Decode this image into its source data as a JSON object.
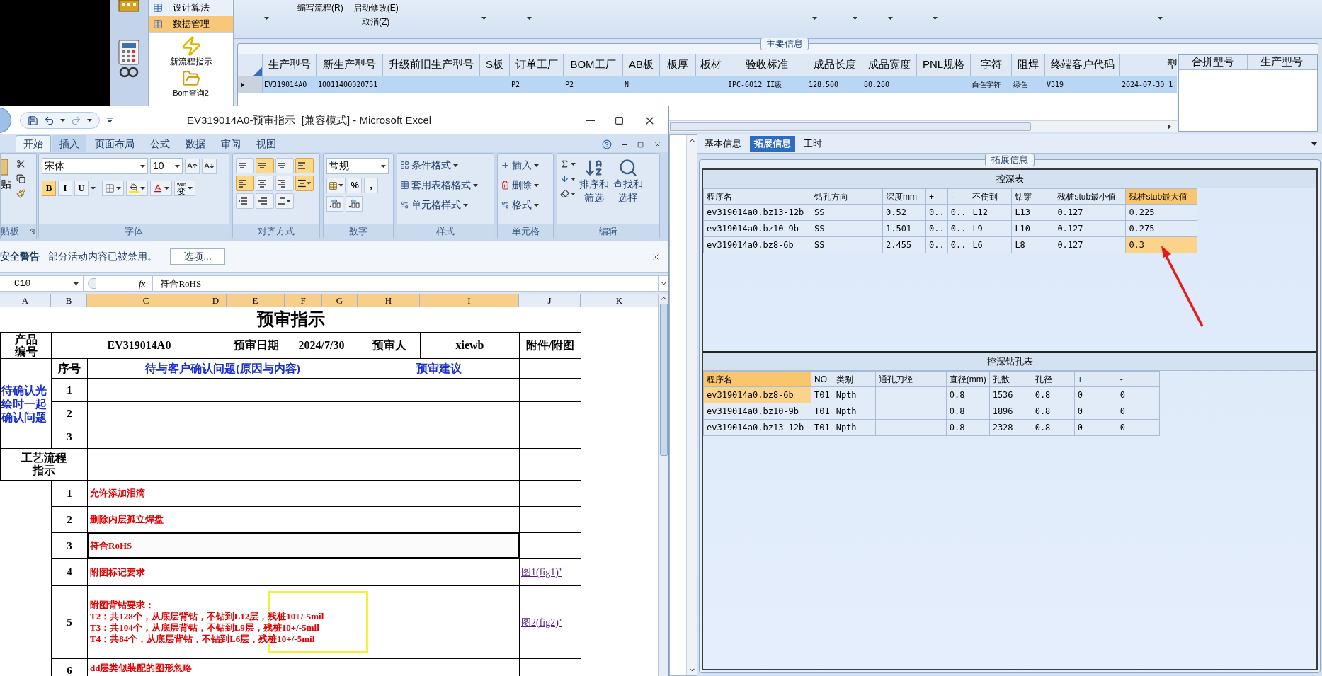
{
  "app": {
    "nav": [
      {
        "label": "设计算法",
        "selected": false
      },
      {
        "label": "数据管理",
        "selected": true
      }
    ],
    "shortcuts": [
      {
        "label": "新流程指示",
        "kind": "flash"
      },
      {
        "label": "Bom查询2",
        "kind": "folder"
      }
    ],
    "toolbar": {
      "left_command": "编写流程(R)",
      "right_commands": [
        "启动修改(E)",
        "取消(Z)"
      ]
    },
    "main_group": {
      "title": "主要信息",
      "columns": [
        "生产型号",
        "新生产型号",
        "升级前旧生产型号",
        "S板",
        "订单工厂",
        "BOM工厂",
        "AB板",
        "板厚",
        "板材",
        "验收标准",
        "成品长度",
        "成品宽度",
        "PNL规格",
        "字符",
        "阻焊",
        "终端客户代码",
        "型"
      ],
      "rows": [
        {
          "selected": true,
          "cells": [
            "EV319014A0",
            "10011400020751",
            null,
            null,
            "P2",
            "P2",
            "N",
            null,
            null,
            "IPC-6012 II级",
            "128.500",
            "80.280",
            null,
            "白色字符",
            "绿色",
            "V319",
            "2024-07-30 1"
          ]
        }
      ]
    },
    "merge_panel": {
      "columns": [
        "合拼型号",
        "生产型号"
      ]
    }
  },
  "excel": {
    "title": "EV319014A0-预审指示  [兼容模式] - Microsoft Excel",
    "tabs": [
      {
        "label": "开始",
        "selected": true
      },
      {
        "label": "插入",
        "selected": false
      },
      {
        "label": "页面布局",
        "selected": false
      },
      {
        "label": "公式",
        "selected": false
      },
      {
        "label": "数据",
        "selected": false
      },
      {
        "label": "审阅",
        "selected": false
      },
      {
        "label": "视图",
        "selected": false
      }
    ],
    "ribbon": {
      "clipboard": {
        "paste": "贴",
        "label": "贴板"
      },
      "font": {
        "name": "宋体",
        "size": "10",
        "buttons": [
          {
            "label": "B",
            "on": true
          },
          {
            "label": "I",
            "on": false
          },
          {
            "label": "U",
            "on": false
          }
        ],
        "phonetic_top": "wén",
        "phonetic": "变",
        "label": "字体"
      },
      "alignment": {
        "buttons": [
          {
            "kind": "top",
            "on": false
          },
          {
            "kind": "middle",
            "on": true
          },
          {
            "kind": "bottom",
            "on": false
          },
          {
            "kind": "wrap",
            "on": true
          },
          {
            "kind": "left",
            "on": true
          },
          {
            "kind": "center",
            "on": false
          },
          {
            "kind": "right",
            "on": false
          },
          {
            "kind": "merge",
            "on": true
          },
          {
            "kind": "outdent",
            "on": false
          },
          {
            "kind": "indent",
            "on": false
          },
          {
            "kind": "orient",
            "on": false
          }
        ],
        "label": "对齐方式"
      },
      "number": {
        "format": "常规",
        "symbols": [
          "%",
          ","
        ],
        "label": "数字"
      },
      "styles": {
        "items": [
          "条件格式",
          "套用表格格式",
          "单元格样式"
        ],
        "label": "样式"
      },
      "cells": {
        "items": [
          "插入",
          "删除",
          "格式"
        ],
        "label": "单元格"
      },
      "editing": {
        "items": [
          "排序和筛选",
          "查找和选择"
        ],
        "label": "编辑"
      }
    },
    "security_bar": {
      "title": "安全警告",
      "message": "部分活动内容已被禁用。",
      "button": "选项..."
    },
    "formula_bar": {
      "name_box": "C10",
      "function_label": "fx",
      "value": "符合RoHS"
    },
    "columns": [
      {
        "label": "A",
        "selected": false
      },
      {
        "label": "B",
        "selected": false
      },
      {
        "label": "C",
        "selected": true
      },
      {
        "label": "D",
        "selected": true
      },
      {
        "label": "E",
        "selected": true
      },
      {
        "label": "F",
        "selected": true
      },
      {
        "label": "G",
        "selected": true
      },
      {
        "label": "H",
        "selected": true
      },
      {
        "label": "I",
        "selected": true
      },
      {
        "label": "J",
        "selected": false
      },
      {
        "label": "K",
        "selected": false
      }
    ],
    "sheet": {
      "title": "预审指示",
      "header": {
        "product_label": "产品编号",
        "product": "EV319014A0",
        "date_label": "预审日期",
        "date": "2024/7/30",
        "reviewer_label": "预审人",
        "reviewer": "xiewb",
        "attachment_label": "附件/附图"
      },
      "questions": {
        "section": "待确认光绘时一起确认问题",
        "no_label": "序号",
        "question_label": "待与客户确认问题(原因与内容)",
        "advice_label": "预审建议",
        "rows": [
          "1",
          "2",
          "3"
        ]
      },
      "process": {
        "section": "工艺流程指示",
        "rows": [
          {
            "no": "1",
            "lines": [
              "允许添加泪滴"
            ],
            "selected": false
          },
          {
            "no": "2",
            "lines": [
              "删除内层孤立焊盘"
            ],
            "selected": false
          },
          {
            "no": "3",
            "lines": [
              "符合RoHS"
            ],
            "selected": true
          },
          {
            "no": "4",
            "lines": [
              "附图标记要求"
            ],
            "selected": false,
            "link": "图1(fig1)’"
          },
          {
            "no": "5",
            "lines": [
              "附图背钻要求：",
              "T2：共128个，从底层背钻，不钻到L12层，残桩10+/-5mil",
              "T3：共104个，从底层背钻，不钻到L9层，残桩10+/-5mil",
              "T4：共84个，从底层背钻，不钻到L6层，残桩10+/-5mil"
            ],
            "selected": false,
            "link": "图2(fig2)’",
            "highlighted": true
          },
          {
            "no": "6",
            "lines": [
              "dd层类似装配的图形忽略"
            ],
            "selected": false
          }
        ]
      }
    }
  },
  "detail": {
    "tabs": [
      {
        "label": "基本信息",
        "selected": false
      },
      {
        "label": "拓展信息",
        "selected": true
      },
      {
        "label": "工时",
        "selected": false
      }
    ],
    "group_title": "拓展信息",
    "depth_table": {
      "title": "控深表",
      "columns": [
        {
          "label": "程序名",
          "selected": false
        },
        {
          "label": "钻孔方向",
          "selected": false
        },
        {
          "label": "深度mm",
          "selected": false
        },
        {
          "label": "+",
          "selected": false
        },
        {
          "label": "-",
          "selected": false
        },
        {
          "label": "不伤到",
          "selected": false
        },
        {
          "label": "钻穿",
          "selected": false
        },
        {
          "label": "残桩stub最小值",
          "selected": false
        },
        {
          "label": "残桩stub最大值",
          "selected": true
        }
      ],
      "rows": [
        {
          "selected": false,
          "cells": [
            "ev319014a0.bz13-12b",
            "SS",
            "0.52",
            "0..",
            "0..",
            "L12",
            "L13",
            "0.127",
            "0.225"
          ]
        },
        {
          "selected": false,
          "cells": [
            "ev319014a0.bz10-9b",
            "SS",
            "1.501",
            "0..",
            "0..",
            "L9",
            "L10",
            "0.127",
            "0.275"
          ]
        },
        {
          "selected": true,
          "cells": [
            "ev319014a0.bz8-6b",
            "SS",
            "2.455",
            "0..",
            "0..",
            "L6",
            "L8",
            "0.127",
            "0.3"
          ]
        }
      ]
    },
    "drill_table": {
      "title": "控深钻孔表",
      "columns": [
        {
          "label": "程序名",
          "selected": true
        },
        {
          "label": "NO",
          "selected": false
        },
        {
          "label": "类别",
          "selected": false
        },
        {
          "label": "通孔刀径",
          "selected": false
        },
        {
          "label": "直径(mm)",
          "selected": false
        },
        {
          "label": "孔数",
          "selected": false
        },
        {
          "label": "孔径",
          "selected": false
        },
        {
          "label": "+",
          "selected": false
        },
        {
          "label": "-",
          "selected": false
        }
      ],
      "rows": [
        {
          "selected": true,
          "cells": [
            "ev319014a0.bz8-6b",
            "T01",
            "Npth",
            null,
            "0.8",
            "1536",
            "0.8",
            "0",
            "0"
          ]
        },
        {
          "selected": false,
          "cells": [
            "ev319014a0.bz10-9b",
            "T01",
            "Npth",
            null,
            "0.8",
            "1896",
            "0.8",
            "0",
            "0"
          ]
        },
        {
          "selected": false,
          "cells": [
            "ev319014a0.bz13-12b",
            "T01",
            "Npth",
            null,
            "0.8",
            "2328",
            "0.8",
            "0",
            "0"
          ]
        }
      ]
    }
  }
}
